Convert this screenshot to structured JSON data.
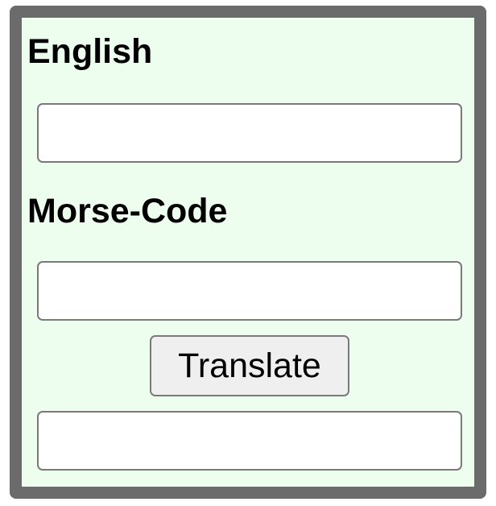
{
  "english": {
    "label": "English",
    "value": "",
    "placeholder": ""
  },
  "morse": {
    "label": "Morse-Code",
    "value": "",
    "placeholder": ""
  },
  "translate_button": {
    "label": "Translate"
  },
  "output": {
    "value": "",
    "placeholder": ""
  },
  "colors": {
    "panel_background": "#eefeee",
    "panel_border": "#6b6b6b",
    "button_background": "#efefef"
  }
}
